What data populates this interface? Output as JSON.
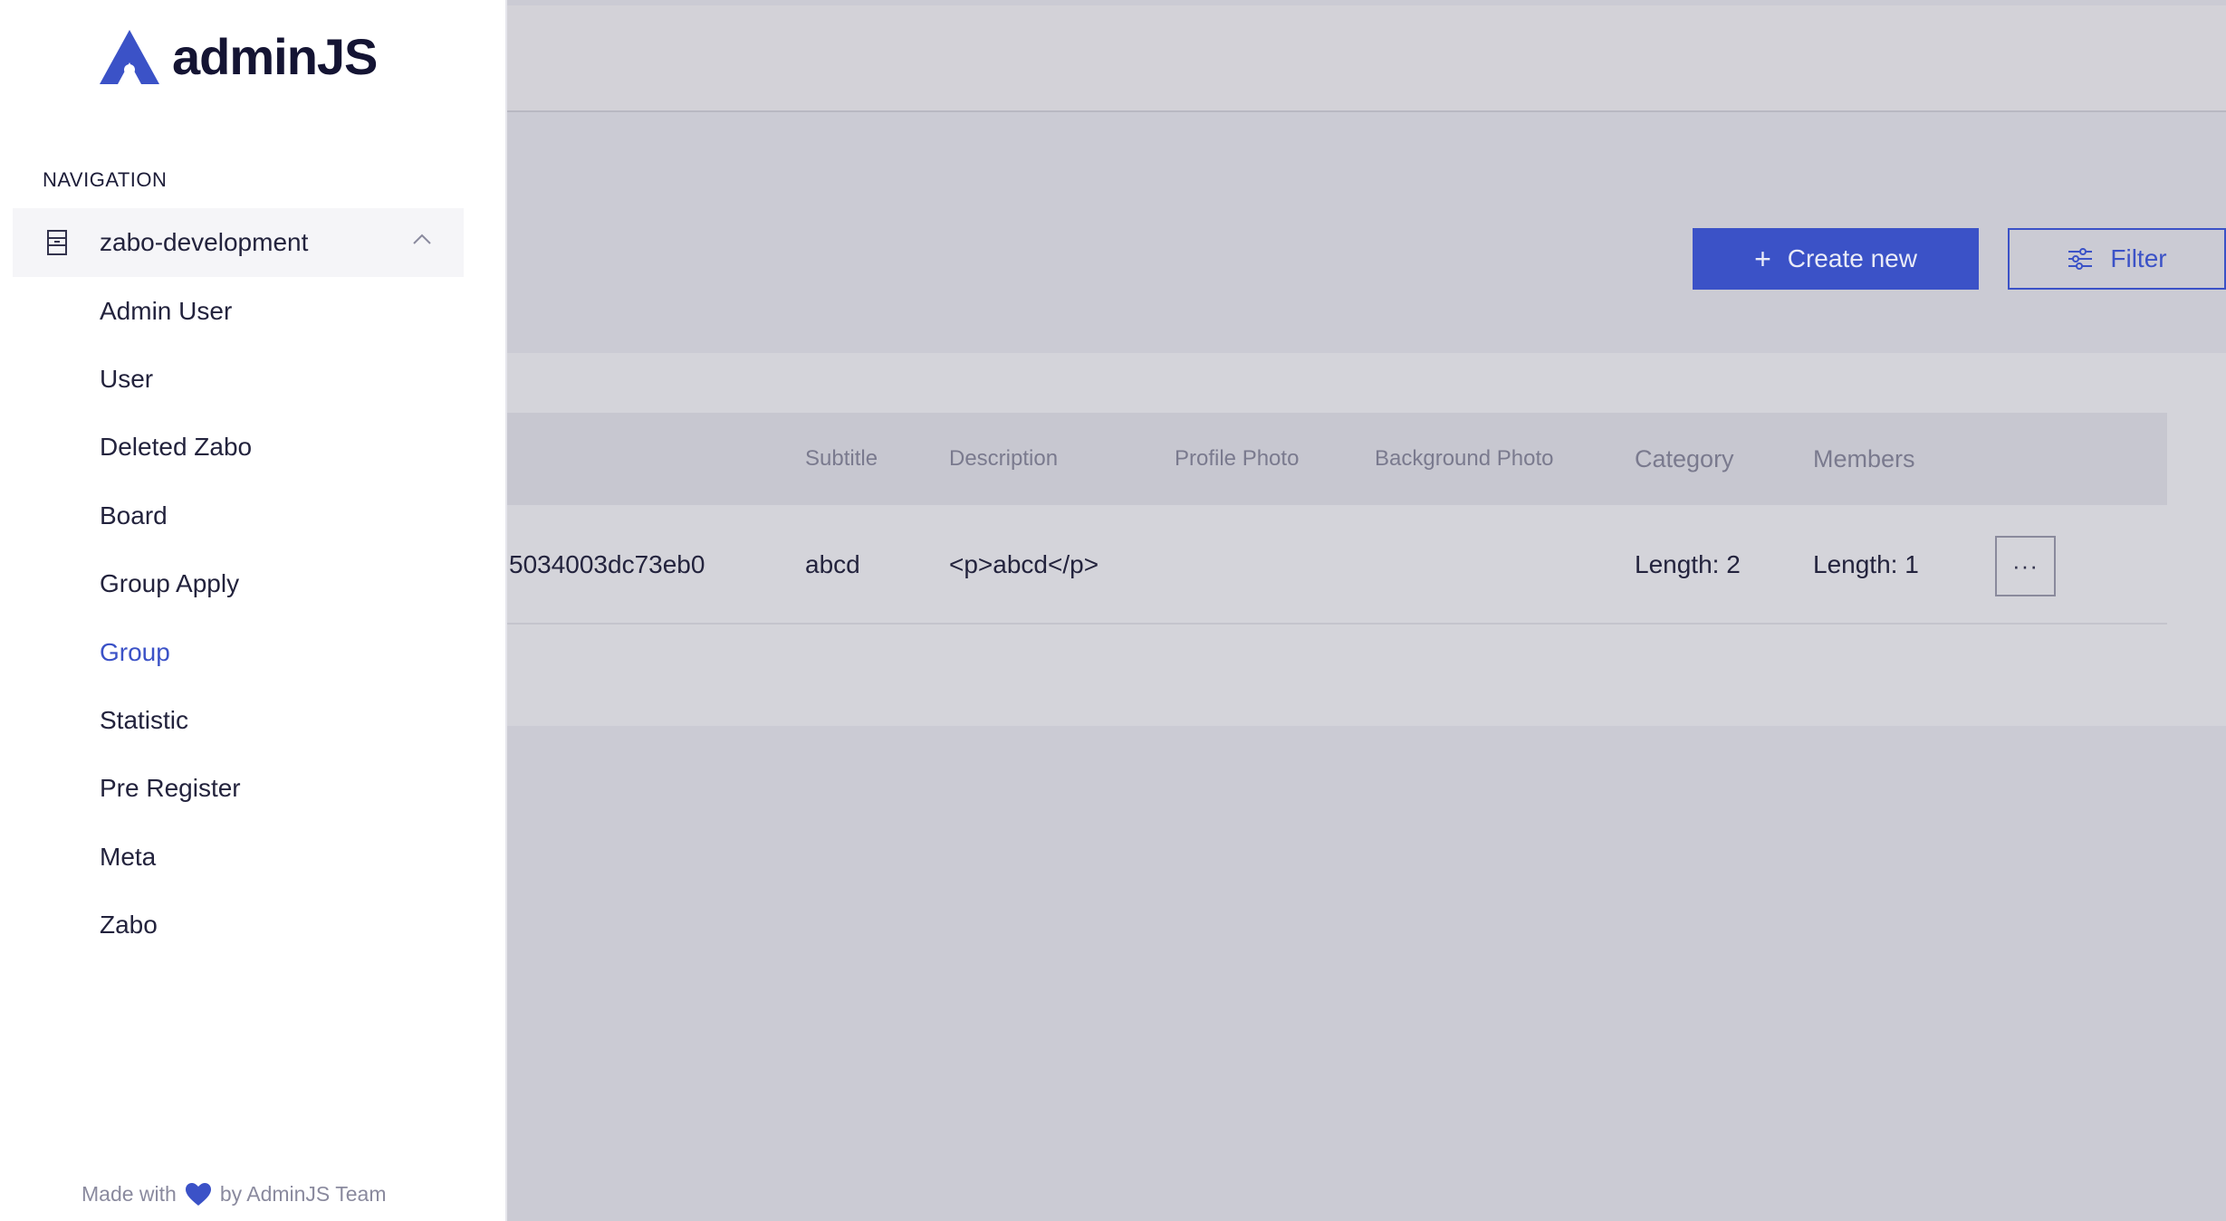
{
  "app": {
    "logo_text": "adminJS",
    "brand_color": "#3b52c7"
  },
  "navigation": {
    "heading": "NAVIGATION",
    "group_label": "zabo-development",
    "items": [
      {
        "label": "Admin User",
        "active": false
      },
      {
        "label": "User",
        "active": false
      },
      {
        "label": "Deleted Zabo",
        "active": false
      },
      {
        "label": "Board",
        "active": false
      },
      {
        "label": "Group Apply",
        "active": false
      },
      {
        "label": "Group",
        "active": true
      },
      {
        "label": "Statistic",
        "active": false
      },
      {
        "label": "Pre Register",
        "active": false
      },
      {
        "label": "Meta",
        "active": false
      },
      {
        "label": "Zabo",
        "active": false
      }
    ]
  },
  "footer": {
    "made_with": "Made with",
    "by": "by AdminJS Team",
    "icon": "heart-icon"
  },
  "actions": {
    "create_label": "Create new",
    "filter_label": "Filter"
  },
  "table": {
    "columns": [
      "Subtitle",
      "Description",
      "Profile Photo",
      "Background Photo",
      "Category",
      "Members"
    ],
    "rows": [
      {
        "id": "5034003dc73eb0",
        "subtitle": "abcd",
        "description": "<p>abcd</p>",
        "profile_photo": "",
        "background_photo": "",
        "category": "Length: 2",
        "members": "Length: 1",
        "more": "···"
      }
    ]
  }
}
